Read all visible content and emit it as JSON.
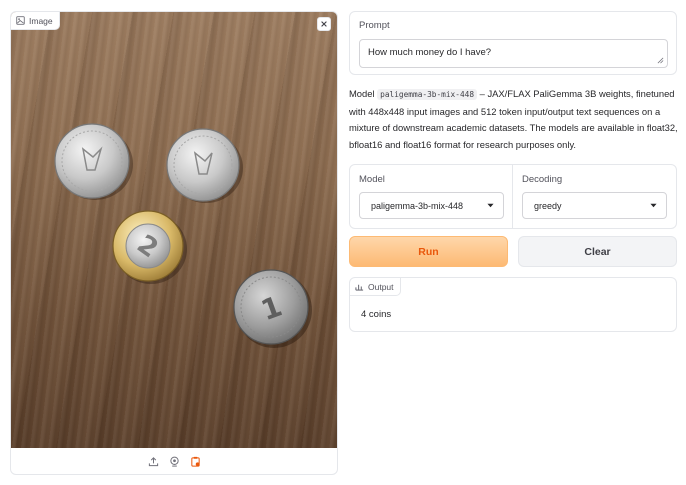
{
  "image_panel": {
    "label": "Image",
    "label_icon": "image-icon",
    "close_icon": "close-icon",
    "coins": [
      {
        "value": "",
        "tone": "silver"
      },
      {
        "value": "",
        "tone": "silver"
      },
      {
        "value": "2",
        "tone": "bimetal"
      },
      {
        "value": "1",
        "tone": "silver"
      }
    ],
    "toolbar_icons": [
      "upload-icon",
      "webcam-icon",
      "clipboard-icon"
    ]
  },
  "prompt": {
    "label": "Prompt",
    "value": "How much money do I have?"
  },
  "description": {
    "prefix": "Model ",
    "model_code": "paligemma-3b-mix-448",
    "text": " – JAX/FLAX PaliGemma 3B weights, finetuned with 448x448 input images and 512 token input/output text sequences on a mixture of downstream academic datasets. The models are available in float32, bfloat16 and float16 format for research purposes only."
  },
  "model_select": {
    "label": "Model",
    "value": "paligemma-3b-mix-448"
  },
  "decoding_select": {
    "label": "Decoding",
    "value": "greedy"
  },
  "buttons": {
    "run_label": "Run",
    "clear_label": "Clear"
  },
  "output": {
    "label": "Output",
    "label_icon": "chart-icon",
    "value": "4 coins"
  },
  "colors": {
    "accent": "#ea580c",
    "run_bg": "#fdba74",
    "border": "#e5e7eb"
  }
}
